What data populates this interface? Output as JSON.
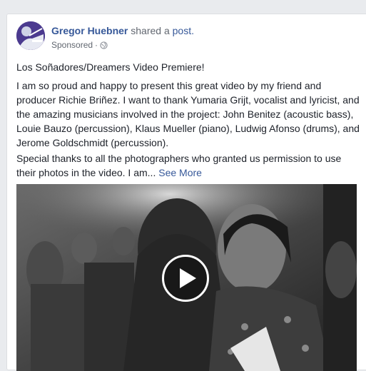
{
  "post": {
    "author": "Gregor Huebner",
    "action": "shared a",
    "link": "post.",
    "sponsored": "Sponsored",
    "separator": "·",
    "audience_icon": "globe-icon",
    "title_line": "Los Soñadores/Dreamers Video Premiere!",
    "paragraph1": "I am so proud and happy to present this great video by my friend and producer Richie Briñez. I want to thank Yumaria Grijt, vocalist and lyricist, and the amazing musicians involved in the project: John Benitez (acoustic bass), Louie Bauzo (percussion), Klaus Mueller (piano), Ludwig Afonso (drums), and Jerome Goldschmidt (percussion).",
    "paragraph2": "Special thanks to all the photographers who granted us permission to use their photos in the video. I am...",
    "see_more": "See More"
  },
  "video": {
    "play_icon": "play-icon"
  },
  "colors": {
    "link": "#365899",
    "text": "#1d2129",
    "meta": "#616770",
    "background": "#e9ebee"
  }
}
